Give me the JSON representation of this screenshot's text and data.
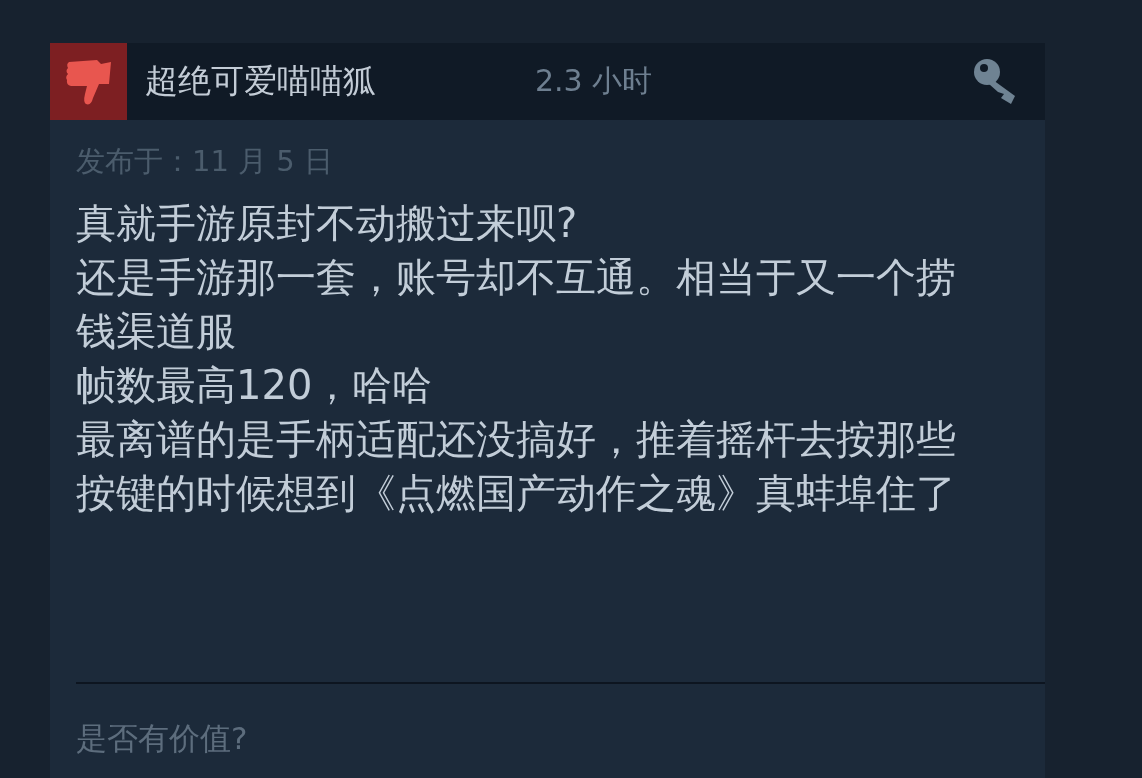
{
  "review": {
    "recommended": false,
    "author": "超绝可爱喵喵狐",
    "playtime": "2.3 小时",
    "posted": "发布于：11 月 5 日",
    "lines": [
      "真就手游原封不动搬过来呗?",
      "还是手游那一套，账号却不互通。相当于又一个捞钱渠道服",
      "帧数最高120，哈哈",
      "最离谱的是手柄适配还没搞好，推着摇杆去按那些按键的时候想到《点燃国产动作之魂》真蚌埠住了"
    ],
    "helpful_prompt": "是否有价值?"
  }
}
